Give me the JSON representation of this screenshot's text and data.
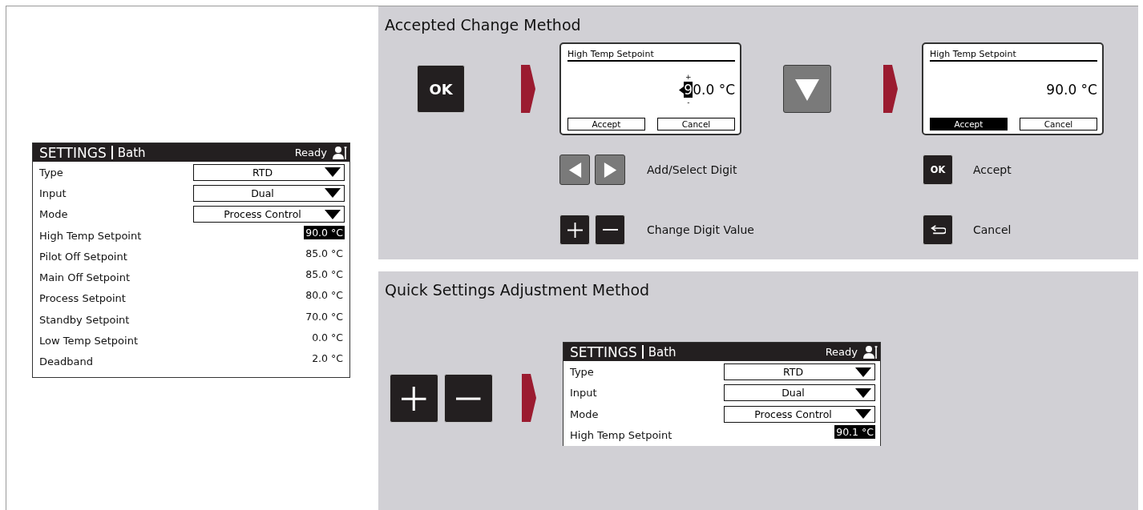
{
  "left_screen": {
    "header": "SETTINGS",
    "location": "Bath",
    "status": "Ready",
    "rows": [
      {
        "kind": "dropdown",
        "label": "Type",
        "value": "RTD"
      },
      {
        "kind": "dropdown",
        "label": "Input",
        "value": "Dual"
      },
      {
        "kind": "dropdown",
        "label": "Mode",
        "value": "Process Control"
      },
      {
        "kind": "value",
        "label": "High Temp Setpoint",
        "value": "90.0 °C",
        "selected": true
      },
      {
        "kind": "value",
        "label": "Pilot Off Setpoint",
        "value": "85.0 °C",
        "selected": false
      },
      {
        "kind": "value",
        "label": "Main Off Setpoint",
        "value": "85.0 °C",
        "selected": false
      },
      {
        "kind": "value",
        "label": "Process Setpoint",
        "value": "80.0 °C",
        "selected": false
      },
      {
        "kind": "value",
        "label": "Standby Setpoint",
        "value": "70.0 °C",
        "selected": false
      },
      {
        "kind": "value",
        "label": "Low Temp Setpoint",
        "value": "0.0 °C",
        "selected": false
      },
      {
        "kind": "value",
        "label": "Deadband",
        "value": "2.0 °C",
        "selected": false
      }
    ]
  },
  "accepted_method": {
    "title": "Accepted Change Method",
    "steps": [
      {
        "kind": "key",
        "key": {
          "kind": "ok",
          "label": "OK"
        }
      },
      {
        "kind": "arrow"
      },
      {
        "kind": "dialog",
        "title": "High Temp Setpoint",
        "digit_up": "+",
        "selected_digit": "9",
        "rest": "0.0 °C",
        "digit_down": "-",
        "buttons": [
          {
            "label": "Accept",
            "selected": false
          },
          {
            "label": "Cancel",
            "selected": false
          }
        ]
      },
      {
        "kind": "key",
        "key": {
          "kind": "down"
        }
      },
      {
        "kind": "arrow"
      },
      {
        "kind": "dialog",
        "title": "High Temp Setpoint",
        "value": "90.0 °C",
        "buttons": [
          {
            "label": "Accept",
            "selected": true
          },
          {
            "label": "Cancel",
            "selected": false
          }
        ]
      }
    ],
    "legend": [
      {
        "keys": [
          {
            "kind": "left"
          },
          {
            "kind": "right"
          }
        ],
        "label": "Add/Select Digit"
      },
      {
        "keys": [
          {
            "kind": "ok",
            "label": "OK"
          }
        ],
        "label": "Accept"
      },
      {
        "keys": [
          {
            "kind": "plus"
          },
          {
            "kind": "minus"
          }
        ],
        "label": "Change Digit Value"
      },
      {
        "keys": [
          {
            "kind": "back"
          }
        ],
        "label": "Cancel"
      }
    ]
  },
  "quick_method": {
    "title": "Quick Settings Adjustment Method",
    "keys": [
      {
        "kind": "plus"
      },
      {
        "kind": "minus"
      }
    ],
    "screen": {
      "cut_off": true,
      "header": "SETTINGS",
      "location": "Bath",
      "status": "Ready",
      "rows": [
        {
          "kind": "dropdown",
          "label": "Type",
          "value": "RTD"
        },
        {
          "kind": "dropdown",
          "label": "Input",
          "value": "Dual"
        },
        {
          "kind": "dropdown",
          "label": "Mode",
          "value": "Process Control"
        },
        {
          "kind": "value",
          "label": "High Temp Setpoint",
          "value": "90.1 °C",
          "selected": true
        }
      ]
    }
  }
}
